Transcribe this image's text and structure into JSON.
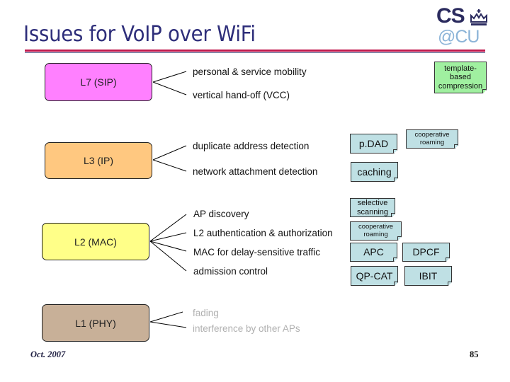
{
  "slide": {
    "title": "Issues for VoIP over WiFi",
    "logo": {
      "line1": "CS",
      "line2": "@CU",
      "emblem": "crown-icon"
    },
    "footer": {
      "date": "Oct. 2007",
      "page": "85"
    },
    "colors": {
      "title": "#2e2e7a",
      "rule": "#c0184e",
      "l7": "#ff80ff",
      "l3": "#ffc880",
      "l2": "#ffff88",
      "l1": "#c8b098",
      "note_blue": "#bfe0e4",
      "note_green": "#a0f0a0",
      "gray_text": "#b0b0b0"
    }
  },
  "layers": [
    {
      "id": "l7",
      "label": "L7 (SIP)",
      "issues": [
        "personal & service mobility",
        "vertical hand-off (VCC)"
      ]
    },
    {
      "id": "l3",
      "label": "L3 (IP)",
      "issues": [
        "duplicate address detection",
        "network attachment detection"
      ]
    },
    {
      "id": "l2",
      "label": "L2 (MAC)",
      "issues": [
        "AP discovery",
        "L2 authentication & authorization",
        "MAC for delay-sensitive traffic",
        "admission control"
      ]
    },
    {
      "id": "l1",
      "label": "L1 (PHY)",
      "issues": [
        "fading",
        "interference by other APs"
      ]
    }
  ],
  "notes": {
    "template_based_compression": "template-based compression",
    "pdad": "p.DAD",
    "cooperative_roaming_l3": "cooperative roaming",
    "caching": "caching",
    "selective_scanning": "selective scanning",
    "cooperative_roaming_l2": "cooperative roaming",
    "apc": "APC",
    "dpcf": "DPCF",
    "qp_cat": "QP-CAT",
    "ibit": "IBIT"
  }
}
